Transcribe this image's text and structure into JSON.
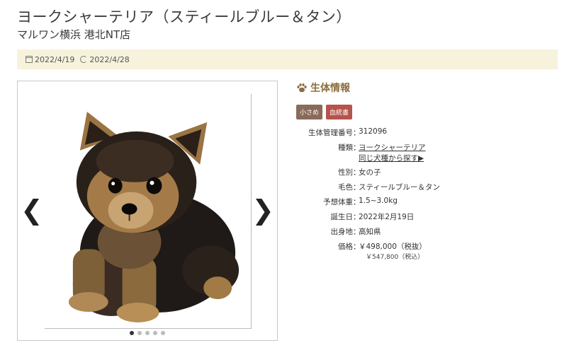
{
  "header": {
    "title": "ヨークシャーテリア（スティールブルー＆タン）",
    "shop": "マルワン横浜 港北NT店"
  },
  "dates": {
    "published": "2022/4/19",
    "updated": "2022/4/28",
    "published_icon": "calendar-icon",
    "updated_icon": "refresh-icon"
  },
  "gallery": {
    "prev_glyph": "❮",
    "next_glyph": "❯",
    "photo_count": 5,
    "active_index": 0
  },
  "info": {
    "heading": "生体情報",
    "heading_icon": "paw-icon",
    "tags": [
      {
        "label": "小さめ",
        "color": "#8a6a5a"
      },
      {
        "label": "血統書",
        "color": "#b5534d"
      }
    ],
    "id_label": "生体管理番号",
    "id_value": "312096",
    "breed_label": "種類",
    "breed_value": "ヨークシャーテリア",
    "breed_search": "同じ犬種から探す▶",
    "sex_label": "性別",
    "sex_value": "女の子",
    "color_label": "毛色",
    "color_value": "スティールブルー＆タン",
    "weight_label": "予想体重",
    "weight_value": "1.5~3.0kg",
    "birthday_label": "誕生日",
    "birthday_value": "2022年2月19日",
    "origin_label": "出身地",
    "origin_value": "高知県",
    "price_label": "価格",
    "price_excl": "￥498,000（税抜）",
    "price_incl": "￥547,800（税込）",
    "separator": "："
  },
  "colors": {
    "datebar_bg": "#f7f2dc",
    "heading": "#8c6d3f"
  }
}
